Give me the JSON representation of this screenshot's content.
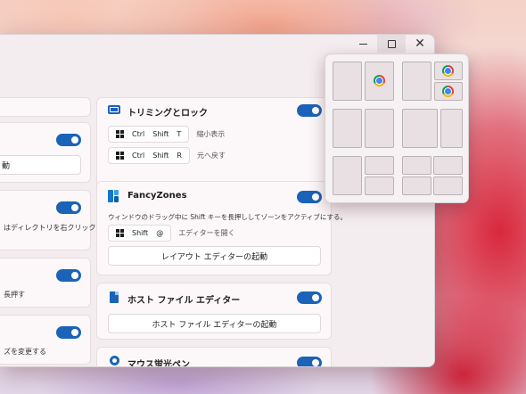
{
  "window": {
    "minimize": "—",
    "maximize": "□",
    "close": "✕"
  },
  "left_cards": {
    "button_partial": "動",
    "desc_partial_1": "はディレクトリを右クリックし",
    "desc_partial_2": "長押す",
    "desc_partial_3": "ズを変更する"
  },
  "trim": {
    "title": "トリミングとロック",
    "shortcut1": {
      "keys": [
        "Ctrl",
        "Shift",
        "T"
      ],
      "label": "縮小表示"
    },
    "shortcut2": {
      "keys": [
        "Ctrl",
        "Shift",
        "R"
      ],
      "label": "元へ戻す"
    }
  },
  "fancyzones": {
    "title": "FancyZones",
    "description": "ウィンドウのドラッグ中に Shift キーを長押ししてゾーンをアクティブにする。",
    "shortcut": {
      "keys": [
        "Shift",
        "@"
      ],
      "label": "エディターを開く"
    },
    "button": "レイアウト エディターの起動"
  },
  "hosts": {
    "title": "ホスト ファイル エディター",
    "button": "ホスト ファイル エディターの起動"
  },
  "mouse": {
    "title": "マウス蛍光ペン"
  },
  "colors": {
    "accent": "#1b63b8",
    "card": "#fcf8f9",
    "window": "#f4edf0"
  }
}
